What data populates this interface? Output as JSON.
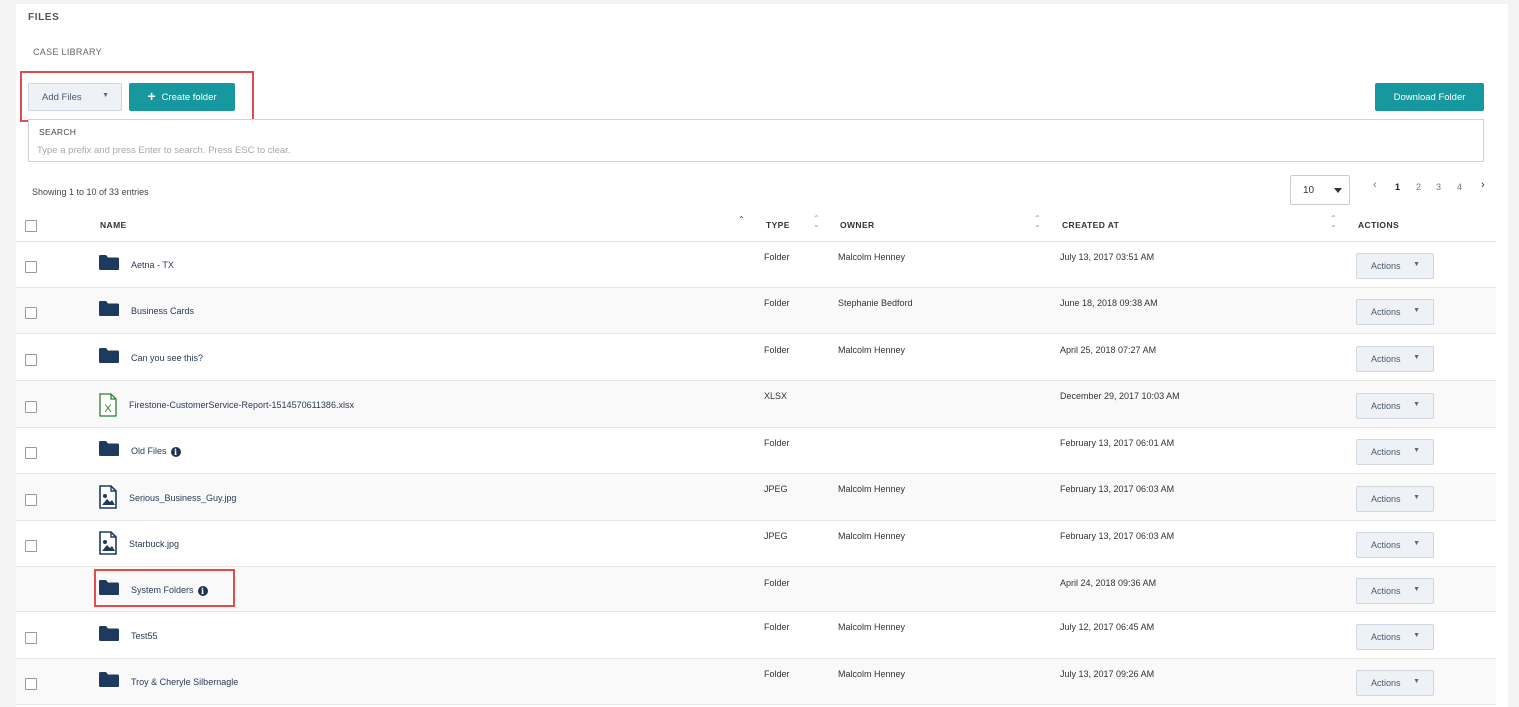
{
  "page": {
    "title": "FILES",
    "breadcrumb": "CASE LIBRARY"
  },
  "toolbar": {
    "add_files_label": "Add Files",
    "create_folder_label": "Create folder",
    "download_folder_label": "Download Folder"
  },
  "search": {
    "label": "SEARCH",
    "placeholder": "Type a prefix and press Enter to search. Press ESC to clear.",
    "value": ""
  },
  "table_info": {
    "showing": "Showing 1 to 10 of 33 entries",
    "page_size": "10"
  },
  "pagination": {
    "prev": "‹",
    "pages": [
      "1",
      "2",
      "3",
      "4"
    ],
    "current_page": "1",
    "next": "›"
  },
  "columns": {
    "name": "NAME",
    "type": "TYPE",
    "owner": "OWNER",
    "created_at": "CREATED AT",
    "actions": "ACTIONS"
  },
  "rows": [
    {
      "name": "Aetna - TX",
      "type": "Folder",
      "owner": "Malcolm Henney",
      "created": "July 13, 2017 03:51 AM",
      "icon": "folder-icon",
      "info": false,
      "checkbox": true,
      "action": "Actions"
    },
    {
      "name": "Business Cards",
      "type": "Folder",
      "owner": "Stephanie Bedford",
      "created": "June 18, 2018 09:38 AM",
      "icon": "folder-icon",
      "info": false,
      "checkbox": true,
      "action": "Actions"
    },
    {
      "name": "Can you see this?",
      "type": "Folder",
      "owner": "Malcolm Henney",
      "created": "April 25, 2018 07:27 AM",
      "icon": "folder-icon",
      "info": false,
      "checkbox": true,
      "action": "Actions"
    },
    {
      "name": "Firestone-CustomerService-Report-1514570611386.xlsx",
      "type": "XLSX",
      "owner": "",
      "created": "December 29, 2017 10:03 AM",
      "icon": "excel-file-icon",
      "info": false,
      "checkbox": true,
      "action": "Actions"
    },
    {
      "name": "Old Files",
      "type": "Folder",
      "owner": "",
      "created": "February 13, 2017 06:01 AM",
      "icon": "folder-icon",
      "info": true,
      "checkbox": true,
      "action": "Actions"
    },
    {
      "name": "Serious_Business_Guy.jpg",
      "type": "JPEG",
      "owner": "Malcolm Henney",
      "created": "February 13, 2017 06:03 AM",
      "icon": "image-file-icon",
      "info": false,
      "checkbox": true,
      "action": "Actions"
    },
    {
      "name": "Starbuck.jpg",
      "type": "JPEG",
      "owner": "Malcolm Henney",
      "created": "February 13, 2017 06:03 AM",
      "icon": "image-file-icon",
      "info": false,
      "checkbox": true,
      "action": "Actions"
    },
    {
      "name": "System Folders",
      "type": "Folder",
      "owner": "",
      "created": "April 24, 2018 09:36 AM",
      "icon": "folder-icon",
      "info": true,
      "checkbox": false,
      "action": "Actions"
    },
    {
      "name": "Test55",
      "type": "Folder",
      "owner": "Malcolm Henney",
      "created": "July 12, 2017 06:45 AM",
      "icon": "folder-icon",
      "info": false,
      "checkbox": true,
      "action": "Actions"
    },
    {
      "name": "Troy & Cheryle Silbernagle",
      "type": "Folder",
      "owner": "Malcolm Henney",
      "created": "July 13, 2017 09:26 AM",
      "icon": "folder-icon",
      "info": false,
      "checkbox": true,
      "action": "Actions"
    }
  ],
  "colors": {
    "accent": "#17989e",
    "highlight": "#e04b4b",
    "folder": "#1f3a5f",
    "excel": "#2e7d32"
  }
}
